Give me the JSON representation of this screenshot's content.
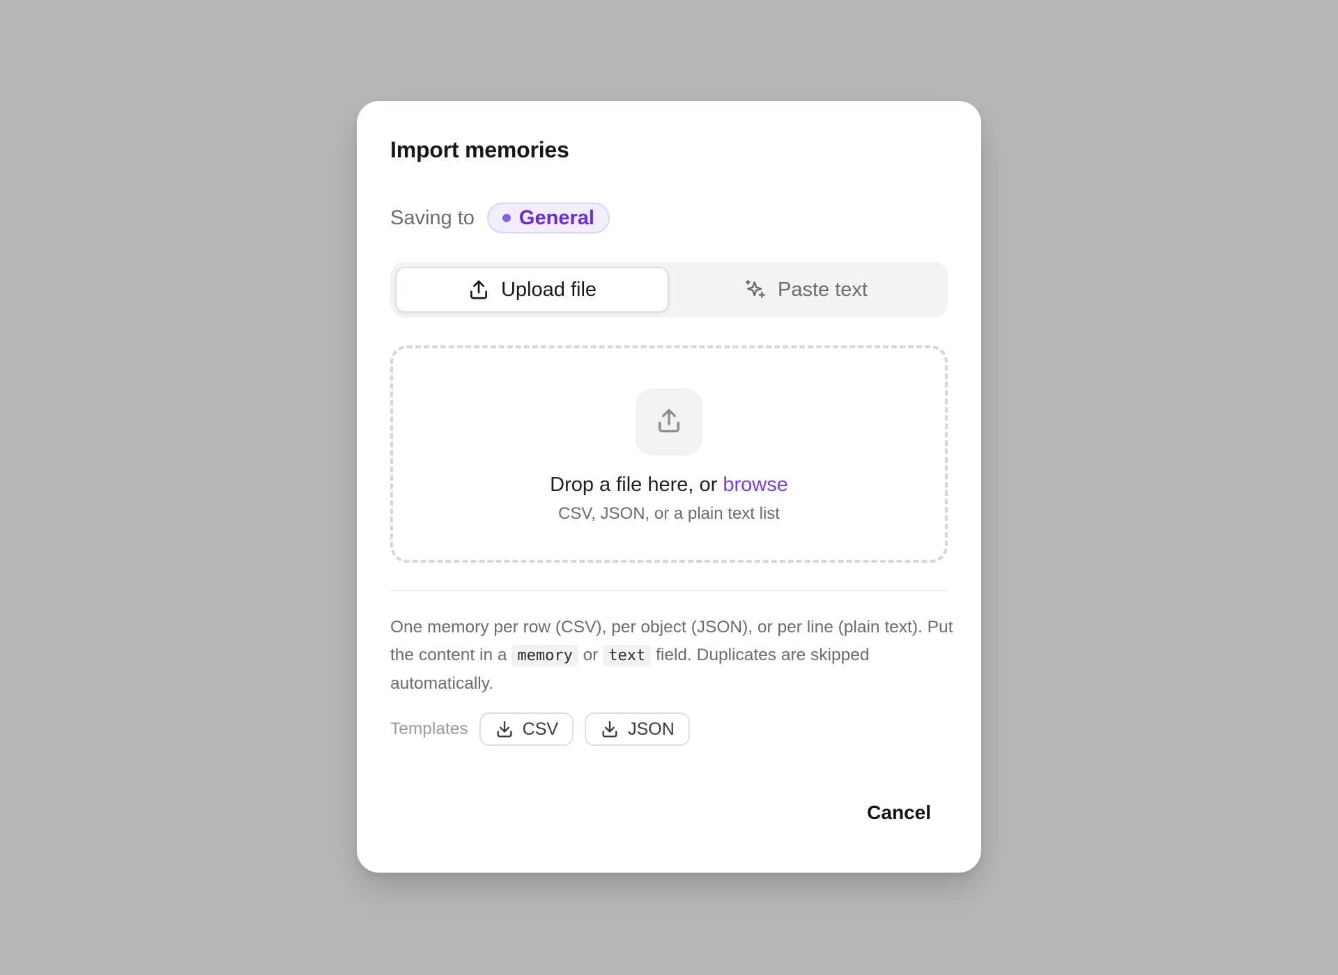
{
  "dialog": {
    "title": "Import memories",
    "saving_to_label": "Saving to",
    "destination": "General",
    "accent_color": "#7c3aed"
  },
  "tabs": [
    {
      "label": "Upload file",
      "icon": "upload-icon",
      "active": true
    },
    {
      "label": "Paste text",
      "icon": "sparkles-icon",
      "active": false
    }
  ],
  "dropzone": {
    "icon": "upload-icon",
    "text_prefix": "Drop a file here, or",
    "browse_label": "browse",
    "formats": "CSV, JSON, or a plain text list"
  },
  "help": {
    "line1": "One memory per row (CSV), per object (JSON), or per line (plain text).",
    "line2_prefix": "Put the content in a",
    "field_memory": "memory",
    "or_word": "or",
    "field_text": "text",
    "line2_suffix": "field. Duplicates are skipped automatically."
  },
  "templates": {
    "label": "Templates",
    "items": [
      {
        "label": "CSV",
        "icon": "download-icon"
      },
      {
        "label": "JSON",
        "icon": "download-icon"
      }
    ]
  },
  "footer": {
    "cancel_label": "Cancel"
  }
}
